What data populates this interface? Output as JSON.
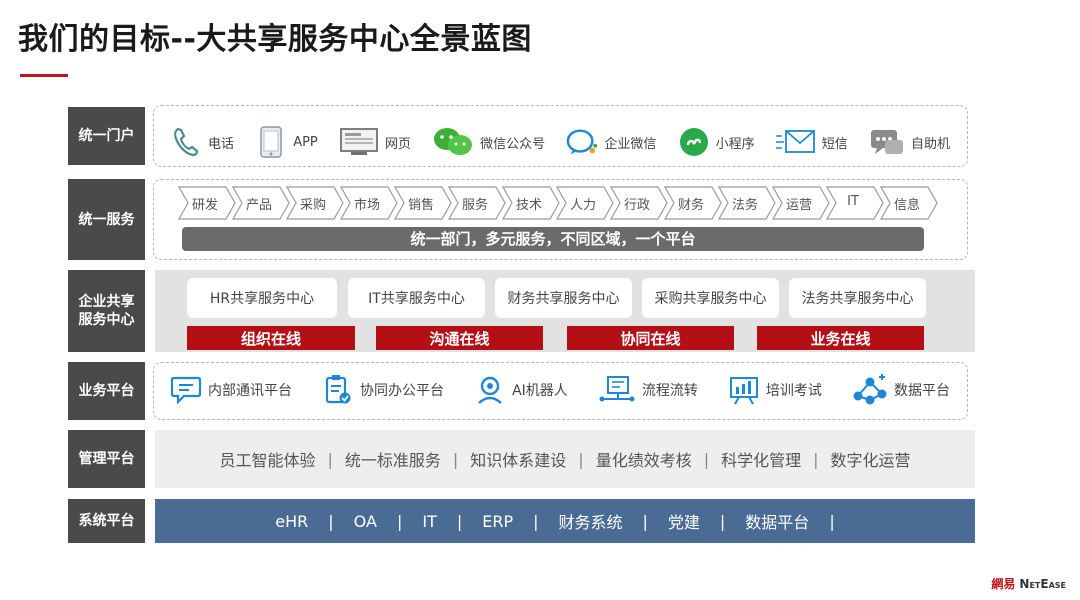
{
  "title": "我们的目标--大共享服务中心全景蓝图",
  "rows": {
    "portal": "统一门户",
    "service": "统一服务",
    "shared_line1": "企业共享",
    "shared_line2": "服务中心",
    "business": "业务平台",
    "management": "管理平台",
    "system": "系统平台"
  },
  "portal_items": [
    {
      "label": "电话",
      "icon": "phone-icon"
    },
    {
      "label": "APP",
      "icon": "app-icon"
    },
    {
      "label": "网页",
      "icon": "webpage-icon"
    },
    {
      "label": "微信公众号",
      "icon": "wechat-icon"
    },
    {
      "label": "企业微信",
      "icon": "enterprise-wechat-icon"
    },
    {
      "label": "小程序",
      "icon": "mini-program-icon"
    },
    {
      "label": "短信",
      "icon": "sms-icon"
    },
    {
      "label": "自助机",
      "icon": "kiosk-icon"
    }
  ],
  "services": [
    "研发",
    "产品",
    "采购",
    "市场",
    "销售",
    "服务",
    "技术",
    "人力",
    "行政",
    "财务",
    "法务",
    "运营",
    "IT",
    "信息"
  ],
  "service_banner": "统一部门，多元服务，不同区域，一个平台",
  "centers": [
    "HR共享服务中心",
    "IT共享服务中心",
    "财务共享服务中心",
    "采购共享服务中心",
    "法务共享服务中心"
  ],
  "online": [
    "组织在线",
    "沟通在线",
    "协同在线",
    "业务在线"
  ],
  "business_items": [
    {
      "label": "内部通讯平台",
      "icon": "chat-icon"
    },
    {
      "label": "协同办公平台",
      "icon": "clipboard-icon"
    },
    {
      "label": "AI机器人",
      "icon": "robot-icon"
    },
    {
      "label": "流程流转",
      "icon": "workflow-icon"
    },
    {
      "label": "培训考试",
      "icon": "training-icon"
    },
    {
      "label": "数据平台",
      "icon": "data-icon"
    }
  ],
  "management_items": [
    "员工智能体验",
    "统一标准服务",
    "知识体系建设",
    "量化绩效考核",
    "科学化管理",
    "数字化运营"
  ],
  "system_items": [
    "eHR",
    "OA",
    "IT",
    "ERP",
    "财务系统",
    "党建",
    "数据平台"
  ],
  "logo_text": "NetEase",
  "logo_cn": "網易",
  "colors": {
    "accent_red": "#b40f15",
    "label_gray": "#4a4a4a",
    "system_blue": "#4a6c94",
    "icon_blue": "#1e88d8",
    "wechat_green": "#3cb034"
  }
}
